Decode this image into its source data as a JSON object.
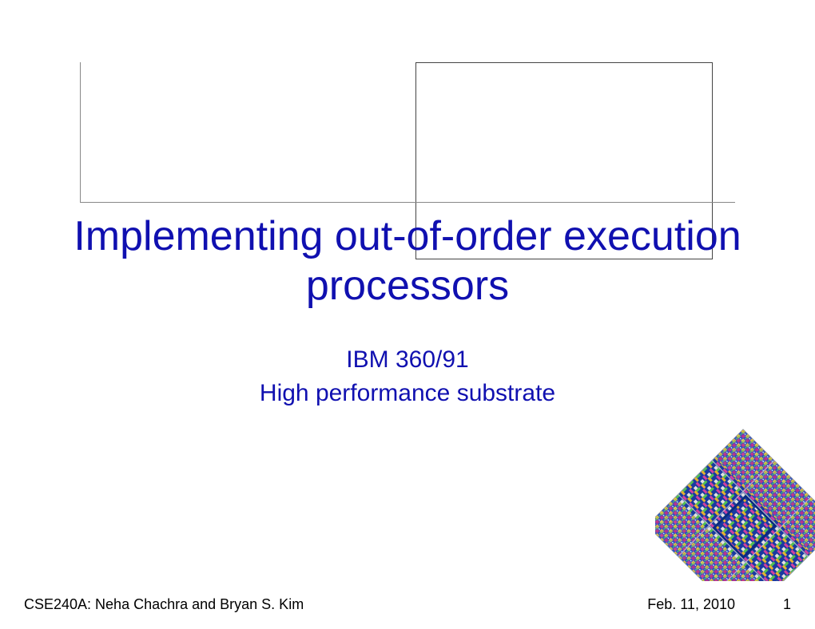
{
  "title": "Implementing out-of-order execution processors",
  "subtitle_line1": "IBM 360/91",
  "subtitle_line2": "High performance substrate",
  "footer": {
    "left": "CSE240A: Neha Chachra and Bryan S. Kim",
    "date": "Feb. 11, 2010",
    "page": "1"
  }
}
